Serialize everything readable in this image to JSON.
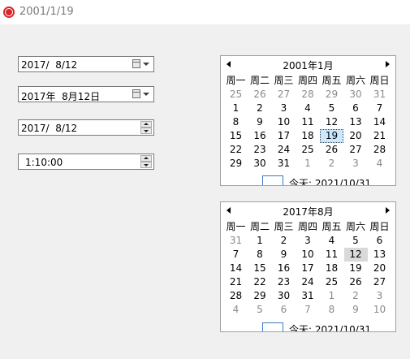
{
  "window": {
    "title": "2001/1/19"
  },
  "controls": {
    "date_dropdown_short": "2017/  8/12",
    "date_dropdown_long": "2017年  8月12日",
    "date_spin": "2017/  8/12",
    "time_spin": "1:10:00"
  },
  "weekdays": [
    "周一",
    "周二",
    "周三",
    "周四",
    "周五",
    "周六",
    "周日"
  ],
  "calendars": [
    {
      "title": "2001年1月",
      "today_label": "今天: 2021/10/31",
      "days": [
        [
          "25",
          "26",
          "27",
          "28",
          "29",
          "30",
          "31"
        ],
        [
          "1",
          "2",
          "3",
          "4",
          "5",
          "6",
          "7"
        ],
        [
          "8",
          "9",
          "10",
          "11",
          "12",
          "13",
          "14"
        ],
        [
          "15",
          "16",
          "17",
          "18",
          "19",
          "20",
          "21"
        ],
        [
          "22",
          "23",
          "24",
          "25",
          "26",
          "27",
          "28"
        ],
        [
          "29",
          "30",
          "31",
          "1",
          "2",
          "3",
          "4"
        ]
      ],
      "dim": [
        [
          true,
          true,
          true,
          true,
          true,
          true,
          true
        ],
        [
          false,
          false,
          false,
          false,
          false,
          false,
          false
        ],
        [
          false,
          false,
          false,
          false,
          false,
          false,
          false
        ],
        [
          false,
          false,
          false,
          false,
          false,
          false,
          false
        ],
        [
          false,
          false,
          false,
          false,
          false,
          false,
          false
        ],
        [
          false,
          false,
          false,
          true,
          true,
          true,
          true
        ]
      ],
      "selected": "19"
    },
    {
      "title": "2017年8月",
      "today_label": "今天: 2021/10/31",
      "days": [
        [
          "31",
          "1",
          "2",
          "3",
          "4",
          "5",
          "6"
        ],
        [
          "7",
          "8",
          "9",
          "10",
          "11",
          "12",
          "13"
        ],
        [
          "14",
          "15",
          "16",
          "17",
          "18",
          "19",
          "20"
        ],
        [
          "21",
          "22",
          "23",
          "24",
          "25",
          "26",
          "27"
        ],
        [
          "28",
          "29",
          "30",
          "31",
          "1",
          "2",
          "3"
        ],
        [
          "4",
          "5",
          "6",
          "7",
          "8",
          "9",
          "10"
        ]
      ],
      "dim": [
        [
          true,
          false,
          false,
          false,
          false,
          false,
          false
        ],
        [
          false,
          false,
          false,
          false,
          false,
          false,
          false
        ],
        [
          false,
          false,
          false,
          false,
          false,
          false,
          false
        ],
        [
          false,
          false,
          false,
          false,
          false,
          false,
          false
        ],
        [
          false,
          false,
          false,
          false,
          true,
          true,
          true
        ],
        [
          true,
          true,
          true,
          true,
          true,
          true,
          true
        ]
      ],
      "selected": "12"
    }
  ]
}
